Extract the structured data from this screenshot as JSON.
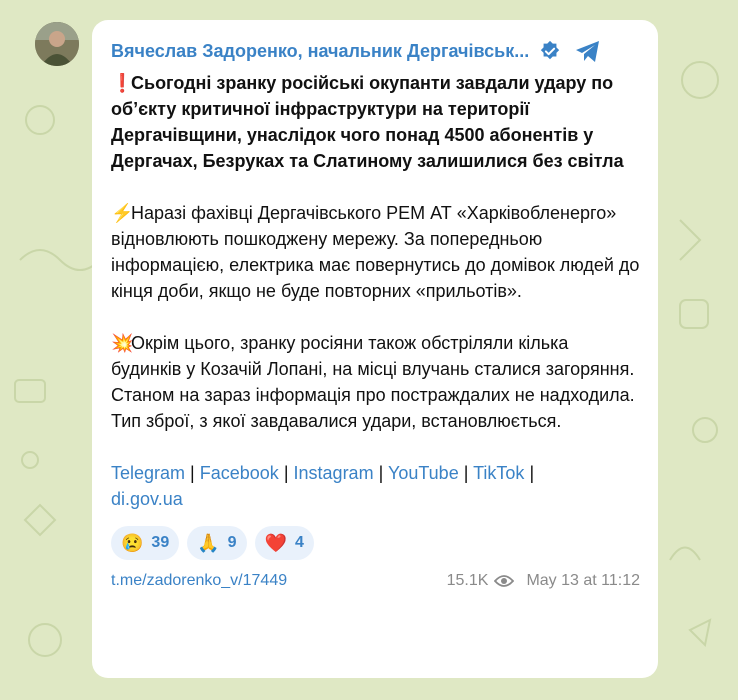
{
  "channel": {
    "name": "Вячеслав Задоренко, начальник Дергачівськ...",
    "verified_icon": "verified-badge-icon",
    "platform_icon": "telegram-icon"
  },
  "post": {
    "lead_emoji": "❗",
    "lead_text": "Сьогодні зранку російські окупанти завдали удару по об’єкту критичної інфраструктури на території Дергачівщини, унаслідок чого понад 4500 абонентів у Дергачах, Безруках та Слатиному залишилися без світла",
    "para2_emoji": "⚡",
    "para2_text": "Наразі фахівці Дергачівського РЕМ АТ «Харківобленерго» відновлюють пошкоджену мережу. За попередньою інформацією, електрика має повернутись до домівок людей до кінця доби, якщо не буде повторних «прильотів».",
    "para3_emoji": "💥",
    "para3_text": "Окрім цього, зранку росіяни також обстріляли кілька будинків у Козачій Лопані, на місці влучань сталися загоряння. Станом на зараз інформація про постраждалих не надходила. Тип зброї, з якої завдавалися удари, встановлюється.",
    "links": {
      "telegram": "Telegram",
      "facebook": "Facebook",
      "instagram": "Instagram",
      "youtube": "YouTube",
      "tiktok": "TikTok",
      "site": "di.gov.ua",
      "separator": "|"
    }
  },
  "reactions": [
    {
      "emoji": "😢",
      "count": "39"
    },
    {
      "emoji": "🙏",
      "count": "9"
    },
    {
      "emoji": "❤️",
      "count": "4"
    }
  ],
  "footer": {
    "post_link": "t.me/zadorenko_v/17449",
    "views": "15.1K",
    "date": "May 13 at 11:12"
  },
  "colors": {
    "background": "#dfe8c4",
    "accent": "#3a82c6",
    "reaction_bg": "#e9f1fb"
  }
}
